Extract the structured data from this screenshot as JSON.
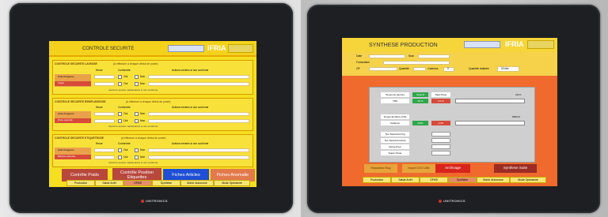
{
  "left_panel": {
    "header_title": "CONTROLE SECURITE",
    "brand_logo": "IFRIA",
    "sections": [
      {
        "title": "CONTROLE SECURITE LAVEUSE",
        "subtitle": "(à effectuer à chaque début de poste)",
        "cols": [
          "Heure",
          "Conformite",
          "Actions menées si non conforme"
        ],
        "rows": [
          {
            "label": "Arrêt d'urgence",
            "oui": "Oui",
            "non": "Non"
          },
          {
            "label": "Capot",
            "oui": "Oui",
            "non": "Non"
          }
        ],
        "footer": "Avertir le service maintenance si non conforme"
      },
      {
        "title": "CONTROLE SECURITE REMPLISSEUSE",
        "subtitle": "(à effectuer à chaque début de poste)",
        "cols": [
          "Heure",
          "Conformite",
          "Actions menées si non conforme"
        ],
        "rows": [
          {
            "label": "Arrêt d'urgence",
            "oui": "Oui",
            "non": "Non"
          },
          {
            "label": "Porte sécurité",
            "oui": "Oui",
            "non": "Non"
          }
        ],
        "footer": "Avertir le service maintenance si non conforme"
      },
      {
        "title": "CONTROLE SECURITE ETIQUETEUSE",
        "subtitle": "(à effectuer à chaque début de poste)",
        "cols": [
          "Heure",
          "Conformite",
          "Actions menées si non conforme"
        ],
        "rows": [
          {
            "label": "Arrêt d'urgence",
            "oui": "Oui",
            "non": "Non"
          },
          {
            "label": "Barrière sécurité",
            "oui": "Oui",
            "non": "Non"
          }
        ],
        "footer": "Avertir le service maintenance si non conforme"
      }
    ],
    "buttons": [
      "Contrôle Poids",
      "Contrôle Position Etiquettes",
      "Fiches Articles",
      "Fiches Anomalie"
    ],
    "tabs": [
      "Production",
      "Saisie Arrêt",
      "OFMS",
      "Synthèse",
      "Maint. Autonome",
      "Mode Opératoire"
    ],
    "device_brand": "UNITRONICS"
  },
  "right_panel": {
    "header_title": "SYNTHESE PRODUCTION",
    "brand_logo": "IFRIA",
    "top_fields": [
      "Date",
      "Nom",
      "Formulation",
      "OF",
      "Quantité",
      "Cadence",
      "Quantité réalisée"
    ],
    "sample_values": {
      "cadence1": "0",
      "cadence2": "0",
      "qte_realisee": "00 litre"
    },
    "table_headers": [
      "Temps de parmtrs",
      "Objectif",
      "Réel Poste"
    ],
    "table_rows": [
      "TRS",
      "Temps de Micro-Arrêt",
      "Cadence",
      "Tps Total Arrêt Org",
      "Tps Total Arrêt Autre",
      "Durée Pour",
      "Durée Poste"
    ],
    "trs_obj": "60 %",
    "trs_real": "0.0 %",
    "cadence_obj": "0000",
    "cadence_real": "0.0/h",
    "bar_labels": [
      "100 %",
      "9999 b/h"
    ],
    "bottom_buttons": [
      "Reparation Bug",
      "Import CSV USB",
      "Archivage",
      "Synthese Suite"
    ],
    "tabs": [
      "Production",
      "Saisie Arrêt",
      "OFMS",
      "Synthèse",
      "Maint. Autonome",
      "Mode Opératoire"
    ],
    "device_brand": "UNITRONICS"
  },
  "colors": {
    "yellow": "#f5df1e",
    "orange": "#ef6a2c",
    "red_button": "#c0392b",
    "blue_button": "#1f4fd6",
    "green_cell": "#2ea84a"
  }
}
